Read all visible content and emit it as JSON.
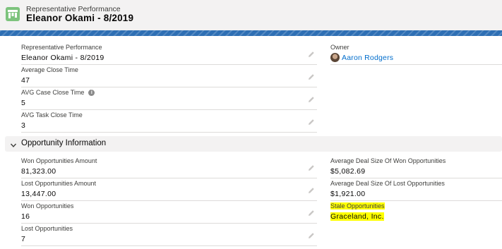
{
  "header": {
    "object_type": "Representative Performance",
    "record_title": "Eleanor Okami - 8/2019"
  },
  "left_fields": [
    {
      "label": "Representative Performance",
      "value": "Eleanor Okami - 8/2019"
    },
    {
      "label": "Average Close Time",
      "value": "47"
    },
    {
      "label": "AVG Case Close Time",
      "value": "5"
    },
    {
      "label": "AVG Task Close Time",
      "value": "3"
    }
  ],
  "owner": {
    "label": "Owner",
    "name": "Aaron Rodgers"
  },
  "section": {
    "title": "Opportunity Information"
  },
  "opp_left": [
    {
      "label": "Won Opportunities Amount",
      "value": "81,323.00"
    },
    {
      "label": "Lost Opportunities Amount",
      "value": "13,447.00"
    },
    {
      "label": "Won Opportunities",
      "value": "16"
    },
    {
      "label": "Lost Opportunities",
      "value": "7"
    }
  ],
  "opp_right": [
    {
      "label": "Average Deal Size Of Won Opportunities",
      "value": "$5,082.69"
    },
    {
      "label": "Average Deal Size Of Lost Opportunities",
      "value": "$1,921.00"
    },
    {
      "label": "Stale Opportunities",
      "value": "Graceland, Inc."
    }
  ],
  "colors": {
    "brand_band": "#2e6fb4",
    "icon_green": "#7dc37d",
    "link_blue": "#006dcc",
    "highlight": "#ffff00"
  },
  "icons": {
    "object": "record-icon",
    "edit": "pencil-icon",
    "help": "info-icon",
    "section_toggle": "chevron-down-icon"
  }
}
